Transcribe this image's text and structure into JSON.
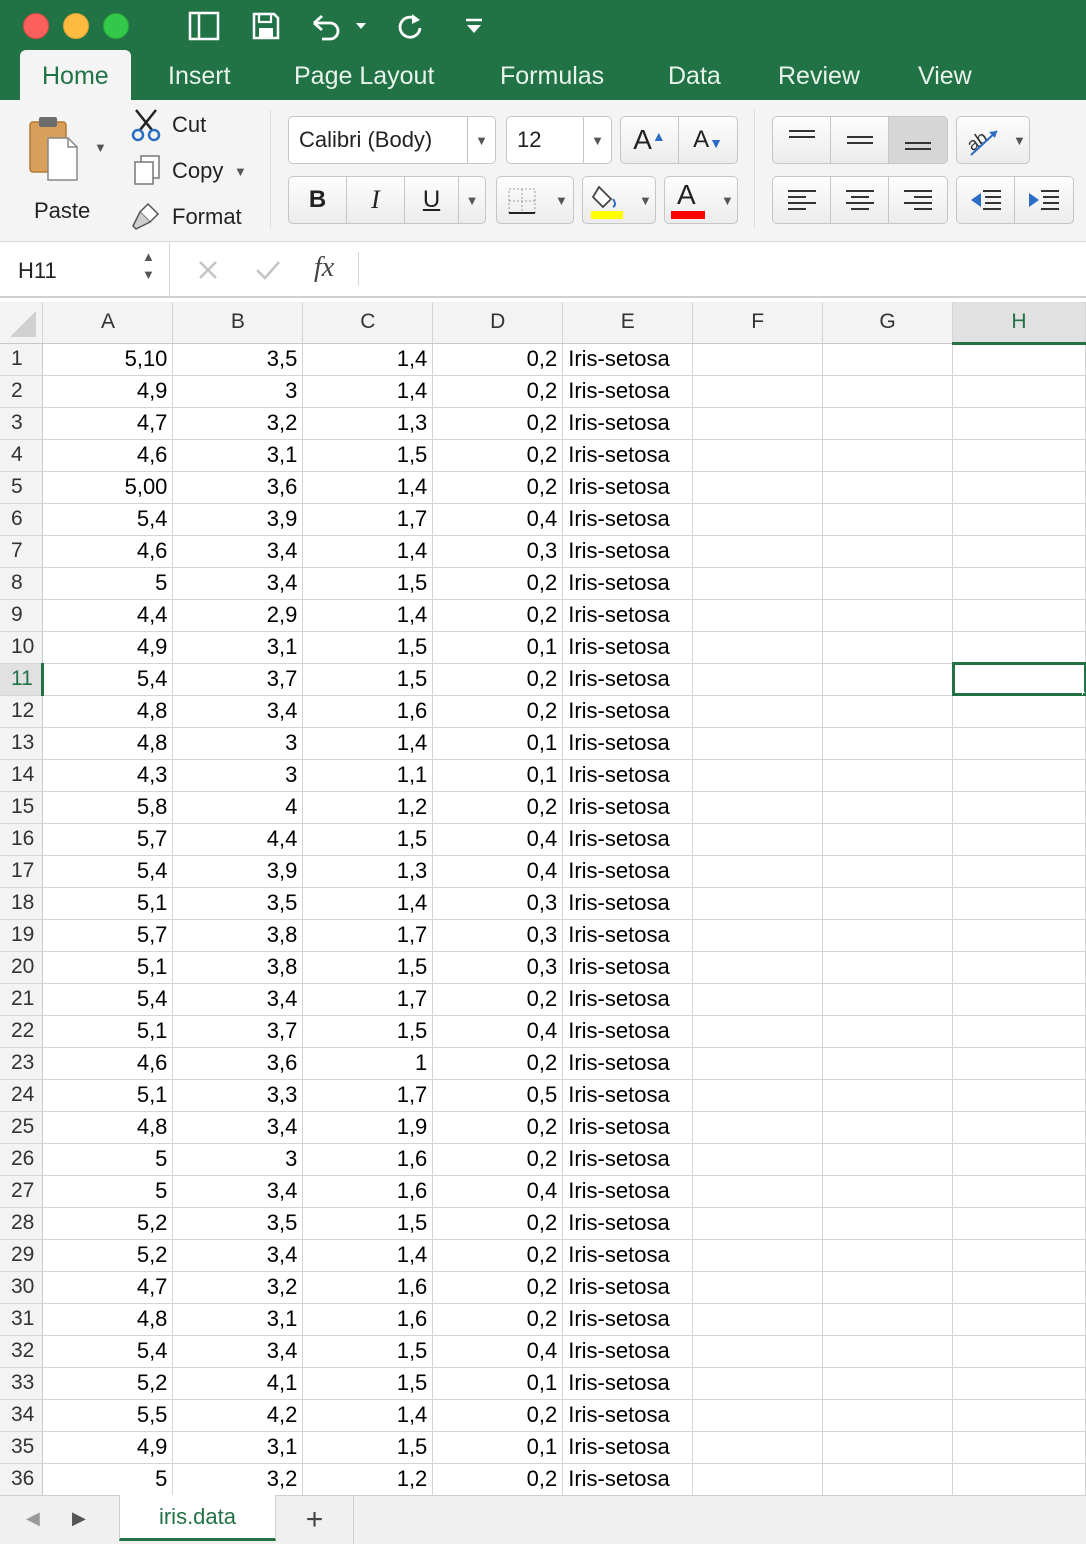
{
  "colors": {
    "brand": "#217346",
    "highlight_fill": "#ffff00",
    "font_color": "#ff0000"
  },
  "titlebar": {
    "quick_access_icons": [
      "sidebar-icon",
      "save-icon",
      "undo-icon",
      "redo-icon",
      "customize-icon"
    ]
  },
  "tabs": [
    {
      "label": "Home",
      "active": true
    },
    {
      "label": "Insert"
    },
    {
      "label": "Page Layout"
    },
    {
      "label": "Formulas"
    },
    {
      "label": "Data"
    },
    {
      "label": "Review"
    },
    {
      "label": "View"
    }
  ],
  "ribbon": {
    "paste_label": "Paste",
    "cut_label": "Cut",
    "copy_label": "Copy",
    "format_label": "Format",
    "font_name": "Calibri (Body)",
    "font_size": "12",
    "bold": "B",
    "italic": "I",
    "underline": "U",
    "grow_font": "A",
    "shrink_font": "A",
    "font_color_glyph": "A"
  },
  "formula_bar": {
    "name_box": "H11",
    "fx": "fx",
    "formula": ""
  },
  "sheet": {
    "columns": [
      "A",
      "B",
      "C",
      "D",
      "E",
      "F",
      "G",
      "H"
    ],
    "selected_column": "H",
    "selected_row": 11,
    "active_cell": "H11",
    "rows": [
      [
        "1",
        "5,10",
        "3,5",
        "1,4",
        "0,2",
        "Iris-setosa"
      ],
      [
        "2",
        "4,9",
        "3",
        "1,4",
        "0,2",
        "Iris-setosa"
      ],
      [
        "3",
        "4,7",
        "3,2",
        "1,3",
        "0,2",
        "Iris-setosa"
      ],
      [
        "4",
        "4,6",
        "3,1",
        "1,5",
        "0,2",
        "Iris-setosa"
      ],
      [
        "5",
        "5,00",
        "3,6",
        "1,4",
        "0,2",
        "Iris-setosa"
      ],
      [
        "6",
        "5,4",
        "3,9",
        "1,7",
        "0,4",
        "Iris-setosa"
      ],
      [
        "7",
        "4,6",
        "3,4",
        "1,4",
        "0,3",
        "Iris-setosa"
      ],
      [
        "8",
        "5",
        "3,4",
        "1,5",
        "0,2",
        "Iris-setosa"
      ],
      [
        "9",
        "4,4",
        "2,9",
        "1,4",
        "0,2",
        "Iris-setosa"
      ],
      [
        "10",
        "4,9",
        "3,1",
        "1,5",
        "0,1",
        "Iris-setosa"
      ],
      [
        "11",
        "5,4",
        "3,7",
        "1,5",
        "0,2",
        "Iris-setosa"
      ],
      [
        "12",
        "4,8",
        "3,4",
        "1,6",
        "0,2",
        "Iris-setosa"
      ],
      [
        "13",
        "4,8",
        "3",
        "1,4",
        "0,1",
        "Iris-setosa"
      ],
      [
        "14",
        "4,3",
        "3",
        "1,1",
        "0,1",
        "Iris-setosa"
      ],
      [
        "15",
        "5,8",
        "4",
        "1,2",
        "0,2",
        "Iris-setosa"
      ],
      [
        "16",
        "5,7",
        "4,4",
        "1,5",
        "0,4",
        "Iris-setosa"
      ],
      [
        "17",
        "5,4",
        "3,9",
        "1,3",
        "0,4",
        "Iris-setosa"
      ],
      [
        "18",
        "5,1",
        "3,5",
        "1,4",
        "0,3",
        "Iris-setosa"
      ],
      [
        "19",
        "5,7",
        "3,8",
        "1,7",
        "0,3",
        "Iris-setosa"
      ],
      [
        "20",
        "5,1",
        "3,8",
        "1,5",
        "0,3",
        "Iris-setosa"
      ],
      [
        "21",
        "5,4",
        "3,4",
        "1,7",
        "0,2",
        "Iris-setosa"
      ],
      [
        "22",
        "5,1",
        "3,7",
        "1,5",
        "0,4",
        "Iris-setosa"
      ],
      [
        "23",
        "4,6",
        "3,6",
        "1",
        "0,2",
        "Iris-setosa"
      ],
      [
        "24",
        "5,1",
        "3,3",
        "1,7",
        "0,5",
        "Iris-setosa"
      ],
      [
        "25",
        "4,8",
        "3,4",
        "1,9",
        "0,2",
        "Iris-setosa"
      ],
      [
        "26",
        "5",
        "3",
        "1,6",
        "0,2",
        "Iris-setosa"
      ],
      [
        "27",
        "5",
        "3,4",
        "1,6",
        "0,4",
        "Iris-setosa"
      ],
      [
        "28",
        "5,2",
        "3,5",
        "1,5",
        "0,2",
        "Iris-setosa"
      ],
      [
        "29",
        "5,2",
        "3,4",
        "1,4",
        "0,2",
        "Iris-setosa"
      ],
      [
        "30",
        "4,7",
        "3,2",
        "1,6",
        "0,2",
        "Iris-setosa"
      ],
      [
        "31",
        "4,8",
        "3,1",
        "1,6",
        "0,2",
        "Iris-setosa"
      ],
      [
        "32",
        "5,4",
        "3,4",
        "1,5",
        "0,4",
        "Iris-setosa"
      ],
      [
        "33",
        "5,2",
        "4,1",
        "1,5",
        "0,1",
        "Iris-setosa"
      ],
      [
        "34",
        "5,5",
        "4,2",
        "1,4",
        "0,2",
        "Iris-setosa"
      ],
      [
        "35",
        "4,9",
        "3,1",
        "1,5",
        "0,1",
        "Iris-setosa"
      ],
      [
        "36",
        "5",
        "3,2",
        "1,2",
        "0,2",
        "Iris-setosa"
      ]
    ]
  },
  "sheet_tabs": [
    {
      "label": "iris.data",
      "active": true
    }
  ],
  "add_sheet_label": "+"
}
